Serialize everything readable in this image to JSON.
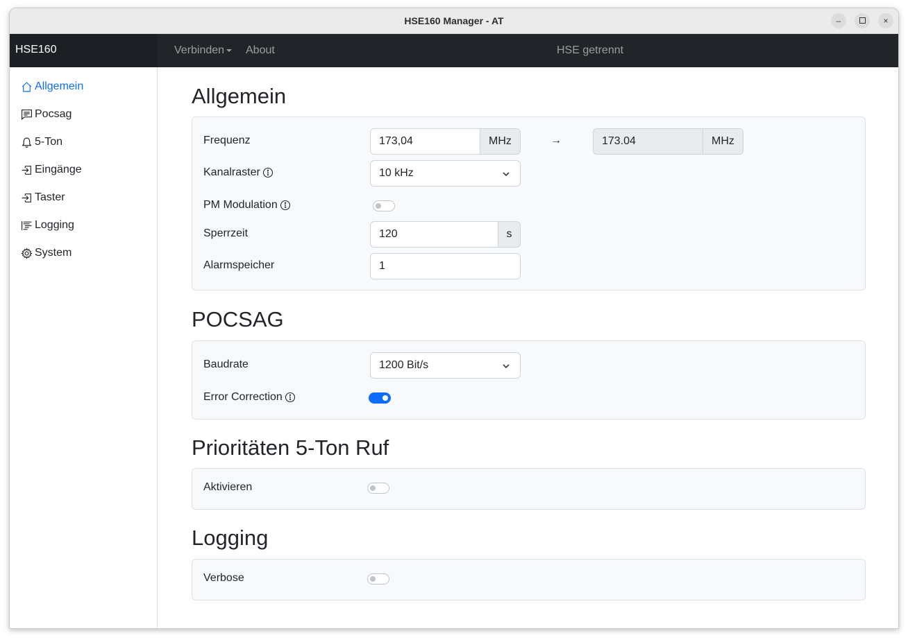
{
  "window": {
    "title": "HSE160 Manager - AT",
    "min_label": "–",
    "close_label": "×"
  },
  "navbar": {
    "brand": "HSE160",
    "connect_label": "Verbinden",
    "about_label": "About",
    "status": "HSE getrennt"
  },
  "sidebar": {
    "items": [
      {
        "label": "Allgemein",
        "icon": "house-icon",
        "active": true
      },
      {
        "label": "Pocsag",
        "icon": "chat-left-text-icon"
      },
      {
        "label": "5-Ton",
        "icon": "bell-icon"
      },
      {
        "label": "Eingänge",
        "icon": "box-arrow-in-right-icon"
      },
      {
        "label": "Taster",
        "icon": "box-arrow-in-right-icon"
      },
      {
        "label": "Logging",
        "icon": "text-indent-icon"
      },
      {
        "label": "System",
        "icon": "gear-icon"
      }
    ]
  },
  "allgemein": {
    "heading": "Allgemein",
    "frequenz_label": "Frequenz",
    "frequenz_value": "173,04",
    "frequenz_unit": "MHz",
    "arrow": "→",
    "frequenz_result": "173.04",
    "frequenz_result_unit": "MHz",
    "kanalraster_label": "Kanalraster",
    "kanalraster_value": "10 kHz",
    "pm_label": "PM Modulation",
    "pm_on": false,
    "sperrzeit_label": "Sperrzeit",
    "sperrzeit_value": "120",
    "sperrzeit_unit": "s",
    "alarmspeicher_label": "Alarmspeicher",
    "alarmspeicher_value": "1"
  },
  "pocsag": {
    "heading": "POCSAG",
    "baudrate_label": "Baudrate",
    "baudrate_value": "1200 Bit/s",
    "error_correction_label": "Error Correction",
    "error_correction_on": true
  },
  "prioritaeten": {
    "heading": "Prioritäten 5-Ton Ruf",
    "aktivieren_label": "Aktivieren",
    "aktivieren_on": false
  },
  "logging": {
    "heading": "Logging",
    "verbose_label": "Verbose",
    "verbose_on": false
  },
  "colors": {
    "accent": "#0d6efd",
    "navbar": "#212529"
  }
}
